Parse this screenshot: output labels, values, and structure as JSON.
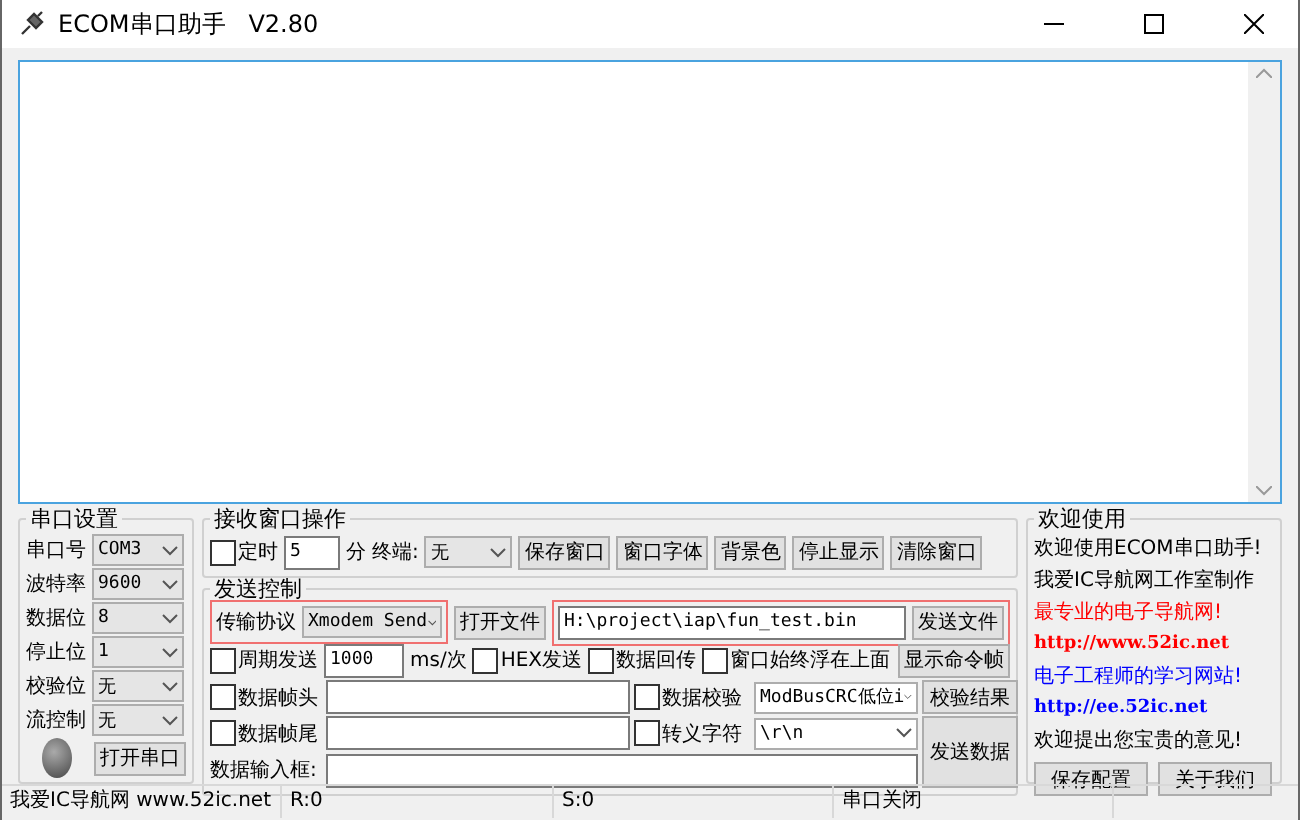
{
  "window": {
    "title": "ECOM串口助手   V2.80"
  },
  "serial_settings": {
    "title": "串口设置",
    "fields": [
      {
        "label": "串口号",
        "value": "COM3"
      },
      {
        "label": "波特率",
        "value": "9600"
      },
      {
        "label": "数据位",
        "value": "8"
      },
      {
        "label": "停止位",
        "value": "1"
      },
      {
        "label": "校验位",
        "value": "无"
      },
      {
        "label": "流控制",
        "value": "无"
      }
    ],
    "open_button": "打开串口"
  },
  "receive_ops": {
    "title": "接收窗口操作",
    "timer": {
      "label": "定时",
      "checked": false,
      "value": "5"
    },
    "unit": "分",
    "terminal": {
      "label": "终端:",
      "value": "无"
    },
    "buttons": [
      "保存窗口",
      "窗口字体",
      "背景色",
      "停止显示",
      "清除窗口"
    ]
  },
  "send_control": {
    "title": "发送控制",
    "protocol": {
      "label": "传输协议",
      "value": "Xmodem Send"
    },
    "open_file_button": "打开文件",
    "file_path": "H:\\project\\iap\\fun_test.bin",
    "send_file_button": "发送文件",
    "periodic": {
      "label": "周期发送",
      "checked": false,
      "value": "1000"
    },
    "unit": "ms/次",
    "options": [
      {
        "label": "HEX发送",
        "checked": false
      },
      {
        "label": "数据回传",
        "checked": false
      },
      {
        "label": "窗口始终浮在上面",
        "checked": false
      }
    ],
    "show_frame_button": "显示命令帧",
    "header": {
      "label": "数据帧头",
      "checked": false
    },
    "checksum": {
      "label": "数据校验",
      "checked": false,
      "value": "ModBusCRC低位i"
    },
    "checksum_result_button": "校验结果",
    "footer": {
      "label": "数据帧尾",
      "checked": false
    },
    "escape": {
      "label": "转义字符",
      "checked": false,
      "value": "\\r\\n"
    },
    "input_label": "数据输入框:",
    "send_button": "发送数据"
  },
  "welcome": {
    "title": "欢迎使用",
    "lines": [
      {
        "text": "欢迎使用ECOM串口助手!",
        "color": "#000000"
      },
      {
        "text": "我爱IC导航网工作室制作",
        "color": "#000000"
      },
      {
        "text": "最专业的电子导航网!",
        "color": "#ff0000"
      },
      {
        "text": "http://www.52ic.net",
        "color": "#ff0000"
      },
      {
        "text": "电子工程师的学习网站!",
        "color": "#0000ff"
      },
      {
        "text": "http://ee.52ic.net",
        "color": "#0000ff"
      },
      {
        "text": "欢迎提出您宝贵的意见!",
        "color": "#000000"
      }
    ],
    "buttons": [
      "保存配置",
      "关于我们"
    ]
  },
  "status_bar": [
    "我爱IC导航网 www.52ic.net",
    "R:0",
    "S:0",
    "串口关闭"
  ]
}
